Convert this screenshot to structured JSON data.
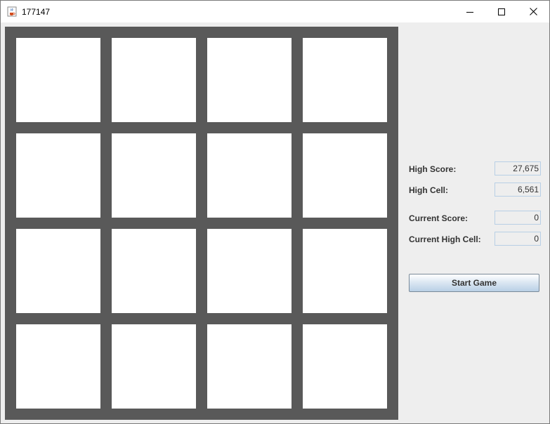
{
  "window": {
    "title": "177147",
    "icon": "java-cup-icon",
    "controls": [
      "minimize",
      "maximize",
      "close"
    ]
  },
  "board": {
    "rows": 4,
    "cols": 4,
    "cells": [
      [
        "",
        "",
        "",
        ""
      ],
      [
        "",
        "",
        "",
        ""
      ],
      [
        "",
        "",
        "",
        ""
      ],
      [
        "",
        "",
        "",
        ""
      ]
    ],
    "colors": {
      "background": "#595959",
      "empty_cell": "#ffffff"
    }
  },
  "stats": {
    "high_score_label": "High Score:",
    "high_score_value": "27,675",
    "high_cell_label": "High Cell:",
    "high_cell_value": "6,561",
    "current_score_label": "Current Score:",
    "current_score_value": "0",
    "current_high_cell_label": "Current High Cell:",
    "current_high_cell_value": "0"
  },
  "controls": {
    "start_label": "Start Game"
  }
}
